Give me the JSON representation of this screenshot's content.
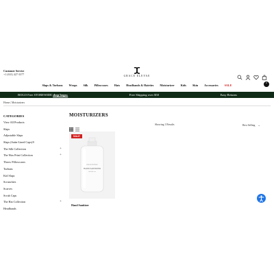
{
  "header": {
    "customer_service_label": "Customer Service",
    "phone": "+1 (631) 427-3377",
    "brand_name": "GRACE ELEYAE",
    "cart_count": "0",
    "icons": [
      "search-icon",
      "user-icon",
      "heart-icon",
      "bag-icon"
    ]
  },
  "nav": {
    "items": [
      "Slaps & Turbans",
      "Wraps",
      "Silk",
      "Pillowcases",
      "Hats",
      "Headbands & Hairties",
      "Moisturizer",
      "Kids",
      "Skin",
      "Accessories",
      "SALE"
    ],
    "sale_color": "#d21f1f"
  },
  "promo": {
    "left": "BOGO Free STOREWIDE",
    "left_link": "shop bogo»",
    "center": "Free Shipping over $50",
    "right": "Easy Returns",
    "background": "#0f2a16"
  },
  "breadcrumb": "Home | Moisturizers",
  "sidebar": {
    "heading": "CATEGORIES",
    "items": [
      {
        "label": "View All Products",
        "expandable": false
      },
      {
        "label": "Slaps",
        "expandable": false
      },
      {
        "label": "Adjustable Slaps",
        "expandable": false
      },
      {
        "label": "Slaps (Satin-Lined Caps)®",
        "expandable": false
      },
      {
        "label": "The Silk Collection",
        "expandable": true
      },
      {
        "label": "The Wax Print Collection",
        "expandable": true
      },
      {
        "label": "Throw Pillowcases",
        "expandable": false
      },
      {
        "label": "Turbans",
        "expandable": false
      },
      {
        "label": "Kid Slaps",
        "expandable": false
      },
      {
        "label": "Scrunchies",
        "expandable": false
      },
      {
        "label": "Scarves",
        "expandable": false
      },
      {
        "label": "Scrub Caps",
        "expandable": false
      },
      {
        "label": "The Hat Collection",
        "expandable": true
      },
      {
        "label": "Headbands",
        "expandable": false
      }
    ]
  },
  "main": {
    "title": "MOISTURIZERS",
    "showing": "Showing 1 Results",
    "sort_label": "Best Selling",
    "product": {
      "badge": "SALE",
      "name": "Hand Sanitizer",
      "bottle_text_top": "GRACE ELEYAE",
      "bottle_text_main": "HAND SANITIZER",
      "bottle_text_sub": "with aloe vera"
    }
  },
  "accessibility_button": "accessibility-icon",
  "colors": {
    "accent": "#d21f1f",
    "promo_bg": "#0f2a16",
    "access_blue": "#1e74e8"
  }
}
